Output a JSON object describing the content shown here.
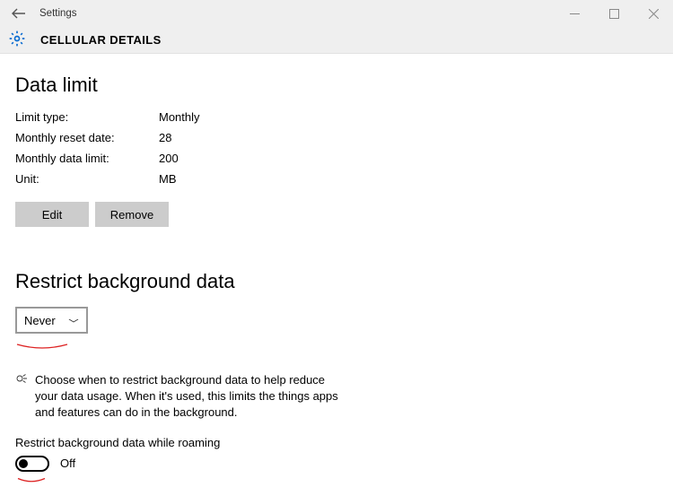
{
  "window": {
    "title": "Settings"
  },
  "header": {
    "title": "CELLULAR DETAILS"
  },
  "sections": {
    "data_limit": {
      "heading": "Data limit",
      "rows": {
        "limit_type_label": "Limit type:",
        "limit_type_value": "Monthly",
        "reset_date_label": "Monthly reset date:",
        "reset_date_value": "28",
        "data_limit_label": "Monthly data limit:",
        "data_limit_value": "200",
        "unit_label": "Unit:",
        "unit_value": "MB"
      },
      "buttons": {
        "edit": "Edit",
        "remove": "Remove"
      }
    },
    "restrict": {
      "heading": "Restrict background data",
      "dropdown_value": "Never",
      "description": "Choose when to restrict background data to help reduce your data usage. When it's used, this limits the things apps and features can do in the background.",
      "roaming_label": "Restrict background data while roaming",
      "toggle_state": "Off"
    }
  }
}
